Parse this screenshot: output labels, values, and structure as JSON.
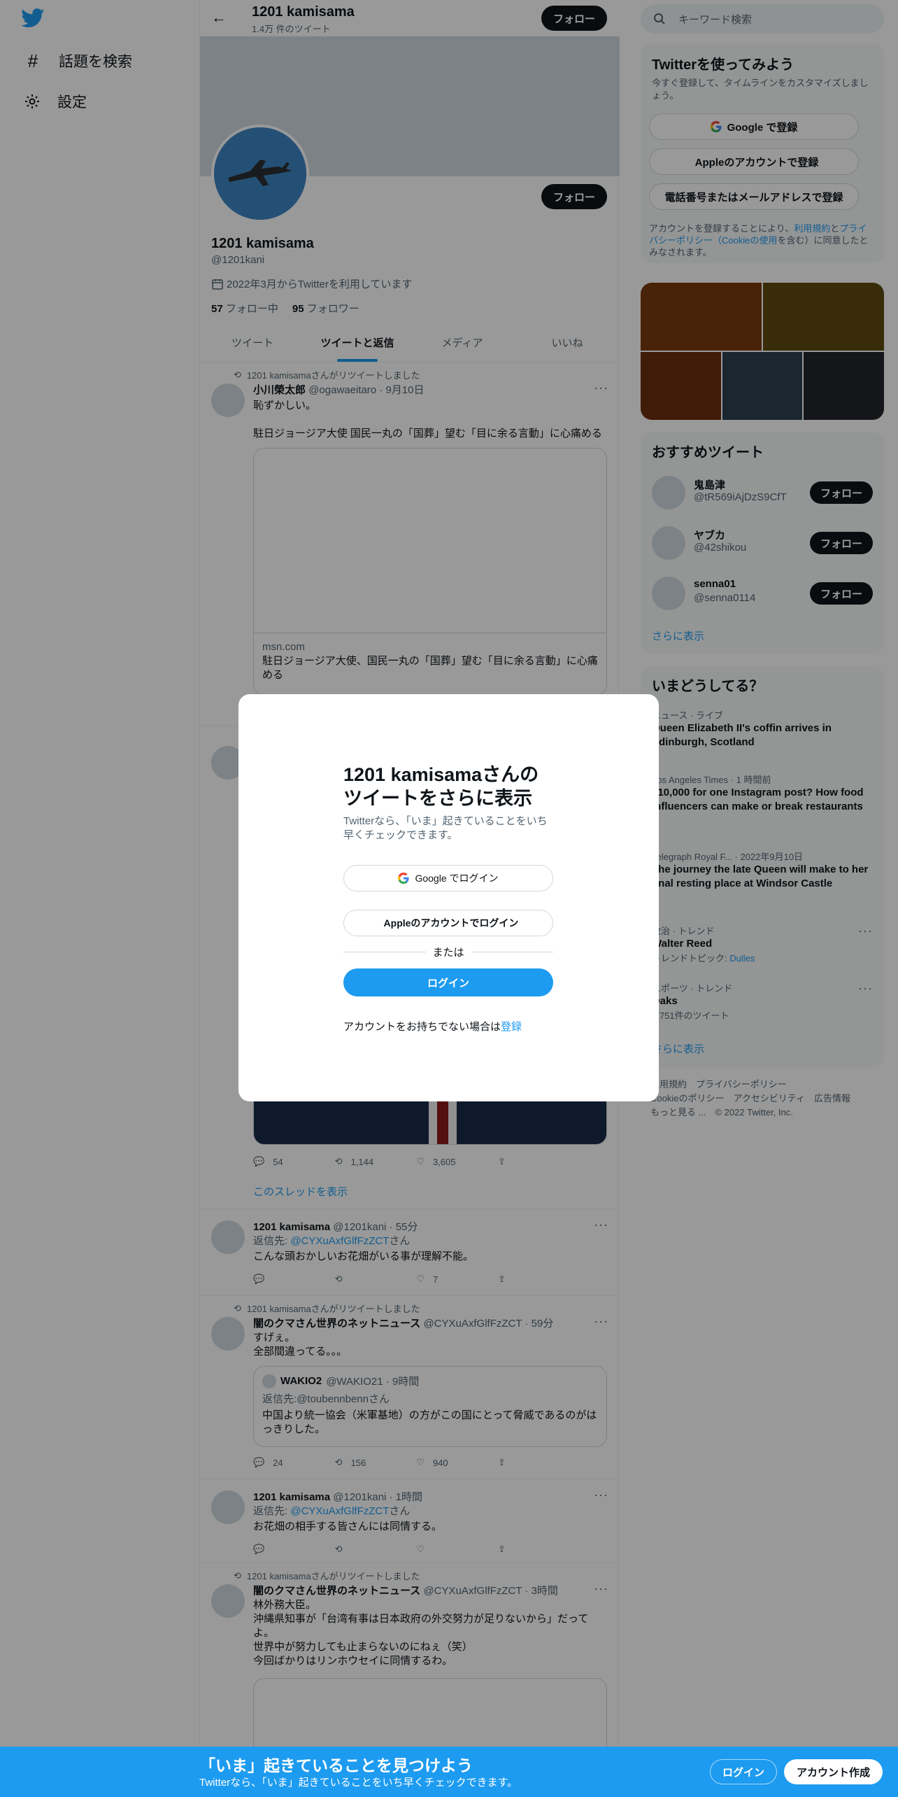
{
  "nav": {
    "items": [
      {
        "label": "話題を検索",
        "icon": "hashtag-icon"
      },
      {
        "label": "設定",
        "icon": "gear-icon"
      }
    ]
  },
  "header": {
    "title": "1201 kamisama",
    "tweet_count": "1.4万 件のツイート",
    "follow_label": "フォロー"
  },
  "profile": {
    "name": "1201 kamisama",
    "handle": "@1201kani",
    "joined": "2022年3月からTwitterを利用しています",
    "following_count": "57",
    "following_label": "フォロー中",
    "followers_count": "95",
    "followers_label": "フォロワー",
    "follow_label": "フォロー"
  },
  "tabs": [
    "ツイート",
    "ツイートと返信",
    "メディア",
    "いいね"
  ],
  "tweets": {
    "t1": {
      "retweet": "1201 kamisamaさんがリツイートしました",
      "name": "小川榮太郎",
      "meta": "@ogawaeitaro · 9月10日",
      "text1": "恥ずかしい。",
      "text2": "駐日ジョージア大使 国民一丸の「国葬」望む「目に余る言動」に心痛める",
      "card_domain": "msn.com",
      "card_title": "駐日ジョージア大使、国民一丸の「国葬」望む「目に余る言動」に心痛める"
    },
    "t2": {
      "replies": "54",
      "retweets": "1,144",
      "likes": "3,605",
      "thread": "このスレッドを表示"
    },
    "t3": {
      "name": "1201 kamisama",
      "meta": "@1201kani · 55分",
      "reply_to_label": "返信先:",
      "reply_to": "@CYXuAxfGlfFzZCT",
      "reply_suffix": "さん",
      "text": "こんな頭おかしいお花畑がいる事が理解不能。",
      "likes": "7"
    },
    "t4": {
      "retweet": "1201 kamisamaさんがリツイートしました",
      "name": "闇のクマさん世界のネットニュース",
      "meta": "@CYXuAxfGlfFzZCT · 59分",
      "text1": "すげぇ。",
      "text2": "全部間違ってる。。。",
      "quote_name": "WAKIO2",
      "quote_meta": "@WAKIO21 · 9時間",
      "quote_reply_label": "返信先:",
      "quote_reply_to": "@toubennbennさん",
      "quote_text": "中国より統一協会（米軍基地）の方がこの国にとって脅威であるのがはっきりした。",
      "replies": "24",
      "retweets": "156",
      "likes": "940"
    },
    "t5": {
      "name": "1201 kamisama",
      "meta": "@1201kani · 1時間",
      "reply_to_label": "返信先:",
      "reply_to": "@CYXuAxfGlfFzZCT",
      "reply_suffix": "さん",
      "text": "お花畑の相手する皆さんには同情する。"
    },
    "t6": {
      "retweet": "1201 kamisamaさんがリツイートしました",
      "name": "闇のクマさん世界のネットニュース",
      "meta": "@CYXuAxfGlfFzZCT · 3時間",
      "line1": "林外務大臣。",
      "line2": "沖縄県知事が「台湾有事は日本政府の外交努力が足りないから」だってよ。",
      "line3": "世界中が努力しても止まらないのにねぇ（笑）",
      "line4": "今回ばかりはリンホウセイに同情するわ。"
    }
  },
  "search": {
    "placeholder": "キーワード検索"
  },
  "signup": {
    "title": "Twitterを使ってみよう",
    "subtitle": "今すぐ登録して、タイムラインをカスタマイズしましょう。",
    "google": "Google で登録",
    "apple": "Appleのアカウントで登録",
    "phone": "電話番号またはメールアドレスで登録",
    "terms_pre": "アカウントを登録することにより、",
    "terms_link": "利用規約",
    "terms_mid": "と",
    "privacy_link": "プライバシーポリシー（Cookieの使用",
    "terms_post": "を含む）に同意したとみなされます。"
  },
  "photo_colors": [
    "#7a3b10",
    "#5e4a10",
    "#6b2d0c",
    "#2d4150",
    "#22262a"
  ],
  "recommend": {
    "title": "おすすめツイート",
    "users": [
      {
        "name": "鬼島津",
        "handle": "@tR569iAjDzS9CfT"
      },
      {
        "name": "ヤブカ",
        "handle": "@42shikou"
      },
      {
        "name": "senna01",
        "handle": "@senna0114"
      }
    ],
    "follow_label": "フォロー",
    "more": "さらに表示"
  },
  "trends": {
    "title": "いまどうしてる？",
    "items": [
      {
        "category": "ニュース · ライブ",
        "title": "Queen Elizabeth II's coffin arrives in Edinburgh, Scotland"
      },
      {
        "category": "Los Angeles Times · 1 時間前",
        "title": "$10,000 for one Instagram post? How food influencers can make or break restaurants"
      },
      {
        "category": "Telegraph Royal F... · 2022年9月10日",
        "title": "The journey the late Queen will make to her final resting place at Windsor Castle"
      },
      {
        "category": "政治 · トレンド",
        "title": "Walter Reed",
        "extra_label": "トレンドトピック:",
        "extra_value": "Dulles"
      },
      {
        "category": "スポーツ · トレンド",
        "title": "Oaks",
        "extra": "1,751件のツイート"
      }
    ],
    "more": "さらに表示"
  },
  "footer": {
    "line1": "利用規約　プライバシーポリシー",
    "line2": "Cookieのポリシー　アクセシビリティ　広告情報",
    "line3": "もっと見る ...　© 2022 Twitter, Inc."
  },
  "modal": {
    "title": "1201 kamisamaさんのツイートをさらに表示",
    "subtitle": "Twitterなら、「いま」起きていることをいち早くチェックできます。",
    "google": "Google でログイン",
    "apple": "Appleのアカウントでログイン",
    "or": "または",
    "login": "ログイン",
    "register_pre": "アカウントをお持ちでない場合は",
    "register_link": "登録"
  },
  "bottom_bar": {
    "title": "「いま」起きていることを見つけよう",
    "subtitle": "Twitterなら、「いま」起きていることをいち早くチェックできます。",
    "login": "ログイン",
    "signup": "アカウント作成"
  }
}
